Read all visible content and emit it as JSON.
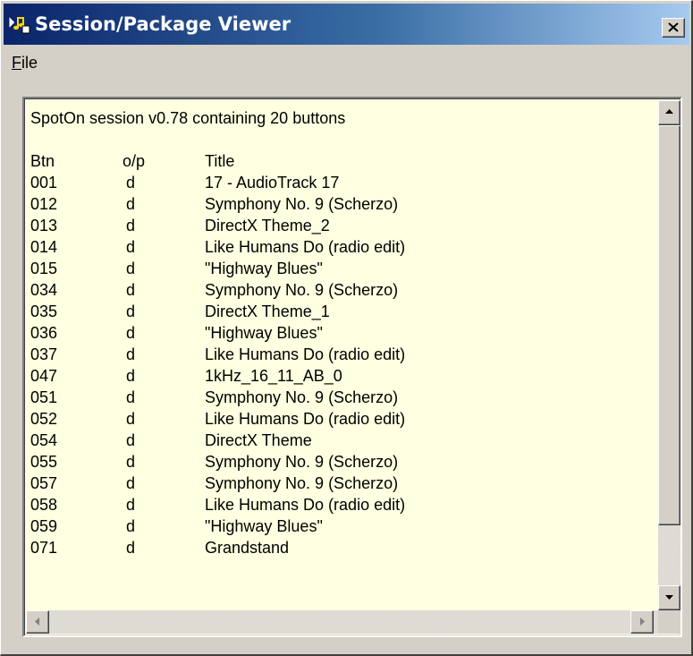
{
  "window": {
    "title": "Session/Package Viewer",
    "close_icon": "close-icon"
  },
  "menu": {
    "file_label_underlined": "F",
    "file_label_rest": "ile"
  },
  "content": {
    "header": "SpotOn session v0.78 containing 20 buttons",
    "columns": {
      "btn": "Btn",
      "op": "o/p",
      "title": "Title"
    },
    "rows": [
      {
        "btn": "001",
        "op": "d",
        "title": "17 - AudioTrack 17"
      },
      {
        "btn": "012",
        "op": "d",
        "title": "Symphony No. 9 (Scherzo)"
      },
      {
        "btn": "013",
        "op": "d",
        "title": "DirectX Theme_2"
      },
      {
        "btn": "014",
        "op": "d",
        "title": "Like Humans Do (radio edit)"
      },
      {
        "btn": "015",
        "op": "d",
        "title": "\"Highway Blues\""
      },
      {
        "btn": "034",
        "op": "d",
        "title": "Symphony No. 9 (Scherzo)"
      },
      {
        "btn": "035",
        "op": "d",
        "title": "DirectX Theme_1"
      },
      {
        "btn": "036",
        "op": "d",
        "title": "\"Highway Blues\""
      },
      {
        "btn": "037",
        "op": "d",
        "title": "Like Humans Do (radio edit)"
      },
      {
        "btn": "047",
        "op": "d",
        "title": "1kHz_16_11_AB_0"
      },
      {
        "btn": "051",
        "op": "d",
        "title": "Symphony No. 9 (Scherzo)"
      },
      {
        "btn": "052",
        "op": "d",
        "title": "Like Humans Do (radio edit)"
      },
      {
        "btn": "054",
        "op": "d",
        "title": "DirectX Theme"
      },
      {
        "btn": "055",
        "op": "d",
        "title": "Symphony No. 9 (Scherzo)"
      },
      {
        "btn": "057",
        "op": "d",
        "title": "Symphony No. 9 (Scherzo)"
      },
      {
        "btn": "058",
        "op": "d",
        "title": "Like Humans Do (radio edit)"
      },
      {
        "btn": "059",
        "op": "d",
        "title": "\"Highway Blues\""
      },
      {
        "btn": "071",
        "op": "d",
        "title": "Grandstand"
      }
    ]
  },
  "colors": {
    "title_gradient_start": "#0a246a",
    "title_gradient_end": "#a6caf0",
    "text_background": "#ffffe1",
    "face": "#d4d0c8"
  }
}
